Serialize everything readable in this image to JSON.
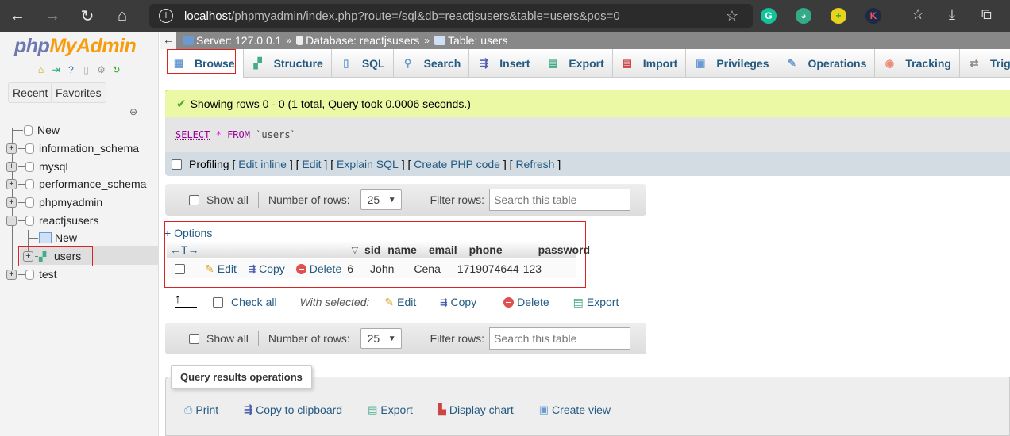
{
  "browser": {
    "url_host": "localhost",
    "url_path": "/phpmyadmin/index.php?route=/sql&db=reactjsusers&table=users&pos=0",
    "extensions": [
      {
        "name": "grammarly-extension-icon",
        "glyph": "G",
        "color": "#15c39a"
      },
      {
        "name": "idm-extension-icon",
        "glyph": "◕",
        "color": "#2a7"
      },
      {
        "name": "plus-extension-icon",
        "glyph": "+",
        "color": "#e8d21d"
      },
      {
        "name": "k-extension-icon",
        "glyph": "K",
        "color": "#1c2a48"
      }
    ]
  },
  "sidebar": {
    "logo_php": "php",
    "logo_myadmin": "MyAdmin",
    "recent_label": "Recent",
    "favorites_label": "Favorites",
    "tree": [
      {
        "label": "New"
      },
      {
        "label": "information_schema"
      },
      {
        "label": "mysql"
      },
      {
        "label": "performance_schema"
      },
      {
        "label": "phpmyadmin"
      },
      {
        "label": "reactjsusers"
      },
      {
        "label": "New"
      },
      {
        "label": "users"
      },
      {
        "label": "test"
      }
    ]
  },
  "breadcrumb": {
    "server": "Server: 127.0.0.1",
    "database": "Database: reactjsusers",
    "table": "Table: users",
    "separator": "»"
  },
  "tabs": [
    {
      "label": "Browse",
      "icon": "▦"
    },
    {
      "label": "Structure",
      "icon": "▞"
    },
    {
      "label": "SQL",
      "icon": "▯"
    },
    {
      "label": "Search",
      "icon": "⚲"
    },
    {
      "label": "Insert",
      "icon": "⇶"
    },
    {
      "label": "Export",
      "icon": "▤"
    },
    {
      "label": "Import",
      "icon": "▤"
    },
    {
      "label": "Privileges",
      "icon": "▣"
    },
    {
      "label": "Operations",
      "icon": "✎"
    },
    {
      "label": "Tracking",
      "icon": "◉"
    },
    {
      "label": "Triggers",
      "icon": "⇄"
    }
  ],
  "message": {
    "success": "Showing rows 0 - 0 (1 total, Query took 0.0006 seconds.)"
  },
  "sql": {
    "select": "SELECT",
    "star": "*",
    "from": "FROM",
    "table": "`users`"
  },
  "profiling": {
    "label": "Profiling",
    "links": [
      "Edit inline",
      "Edit",
      "Explain SQL",
      "Create PHP code",
      "Refresh"
    ]
  },
  "navbar": {
    "show_all": "Show all",
    "number_of_rows_label": "Number of rows:",
    "number_of_rows_value": "25",
    "filter_label": "Filter rows:",
    "filter_placeholder": "Search this table"
  },
  "results": {
    "options_label": "+ Options",
    "columns": [
      "sid",
      "name",
      "email",
      "phone",
      "password"
    ],
    "rows": [
      {
        "sid": "6",
        "name": "John",
        "email": "Cena",
        "phone": "1719074644",
        "password": "123"
      }
    ],
    "row_actions": {
      "edit": "Edit",
      "copy": "Copy",
      "delete": "Delete"
    }
  },
  "bulk": {
    "check_all": "Check all",
    "with_selected": "With selected:",
    "edit": "Edit",
    "copy": "Copy",
    "delete": "Delete",
    "export": "Export"
  },
  "query_ops": {
    "legend": "Query results operations",
    "items": [
      "Print",
      "Copy to clipboard",
      "Export",
      "Display chart",
      "Create view"
    ]
  }
}
